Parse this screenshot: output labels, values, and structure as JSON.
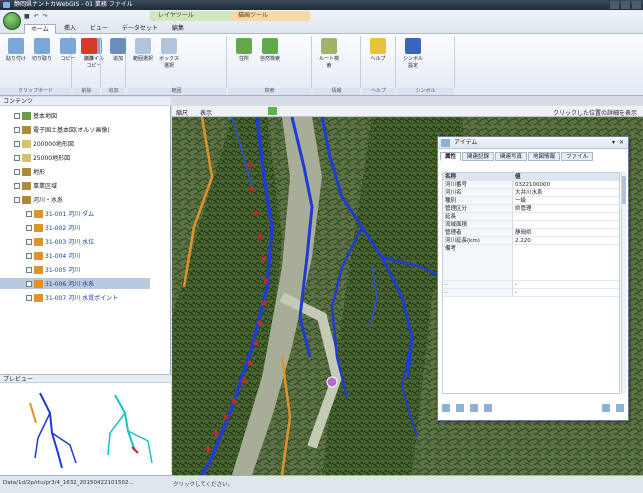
{
  "window": {
    "title": "静岡県ナントカWebGIS - 01 業務 ファイル"
  },
  "ribbon": {
    "context_groups": [
      "レイヤツール",
      "描画ツール"
    ],
    "tabs": [
      "ホーム",
      "挿入",
      "ビュー",
      "データセット",
      "編集"
    ],
    "active_tab": "ホーム",
    "groups": [
      {
        "label": "クリップボード",
        "buttons": [
          "貼り付け",
          "切り取り",
          "コピー",
          "スタイルコピー"
        ]
      },
      {
        "label": "削除",
        "buttons": [
          "削除"
        ]
      },
      {
        "label": "追加",
        "buttons": [
          "追加"
        ]
      },
      {
        "label": "範囲",
        "buttons": [
          "範囲選択",
          "ボックス選択"
        ]
      },
      {
        "label": "検索",
        "buttons": [
          "住所",
          "自然検索"
        ]
      },
      {
        "label": "情報",
        "buttons": [
          "ルート検索"
        ]
      },
      {
        "label": "ヘルプ",
        "buttons": [
          "ヘルプ"
        ]
      },
      {
        "label": "シンボル",
        "buttons": [
          "シンボル設定"
        ]
      }
    ]
  },
  "contents_panel": {
    "title": "コンテンツ",
    "layers": [
      {
        "label": "基本地図",
        "level": 0,
        "linked": false
      },
      {
        "label": "電子国土基本図(オルソ画像)",
        "level": 0,
        "linked": false
      },
      {
        "label": "200000地形図",
        "level": 0,
        "linked": false
      },
      {
        "label": "25000地形図",
        "level": 0,
        "linked": false
      },
      {
        "label": "地形",
        "level": 0,
        "linked": false
      },
      {
        "label": "事業区域",
        "level": 0,
        "linked": false
      },
      {
        "label": "河川・水系",
        "level": 0,
        "linked": false
      },
      {
        "label": "31-001 河川 ダム",
        "level": 1,
        "linked": true
      },
      {
        "label": "31-002 河川",
        "level": 1,
        "linked": true
      },
      {
        "label": "31-003 河川 水位",
        "level": 1,
        "linked": true
      },
      {
        "label": "31-004 河川",
        "level": 1,
        "linked": true
      },
      {
        "label": "31-005 河川",
        "level": 1,
        "linked": true
      },
      {
        "label": "31-006 河川 水系",
        "level": 1,
        "linked": true,
        "selected": true
      },
      {
        "label": "31-007 河川 水質ポイント",
        "level": 1,
        "linked": true
      }
    ]
  },
  "preview_panel": {
    "title": "プレビュー"
  },
  "map_toolbar": {
    "items": [
      "縮尺",
      "表示"
    ],
    "right_hint": "クリックした位置の詳細を表示"
  },
  "attribute_window": {
    "title": "アイテム",
    "tabs": [
      "属性",
      "関連記録",
      "関連写真",
      "地図情報",
      "ファイル"
    ],
    "active_tab": "属性",
    "header": {
      "key": "名称",
      "value": "値"
    },
    "rows": [
      {
        "k": "河川番号",
        "v": "0322100000"
      },
      {
        "k": "河川名",
        "v": "大井川水系"
      },
      {
        "k": "種別",
        "v": "一級"
      },
      {
        "k": "管理区分",
        "v": "県管理"
      },
      {
        "k": "延長",
        "v": ""
      },
      {
        "k": "流域面積",
        "v": ""
      },
      {
        "k": "管理者",
        "v": "静岡県"
      },
      {
        "k": "河川延長(km)",
        "v": "2.220"
      },
      {
        "k": "備考",
        "v": "",
        "tall": true
      },
      {
        "k": "-",
        "v": "-"
      },
      {
        "k": "-",
        "v": "-"
      }
    ]
  },
  "status_bar": {
    "left_text": "Data/1d/2p/rtu/pr3/4_1632_20150422101502...",
    "hint": "クリックしてください。"
  },
  "colors": {
    "river_main": "#1f3bd6",
    "road": "#e0922a",
    "marker": "#c0282e",
    "vegetation": "#2c5a16",
    "terrain": "#8d9a7c"
  }
}
